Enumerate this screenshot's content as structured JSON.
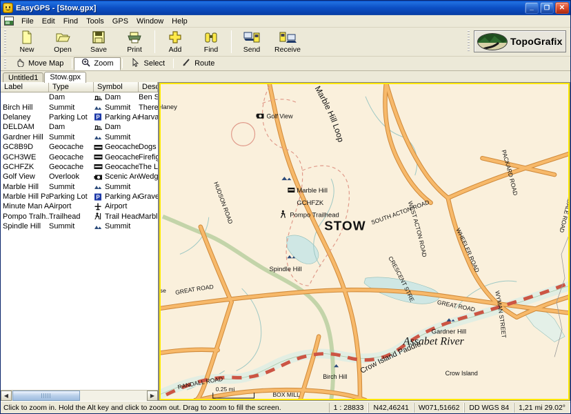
{
  "window": {
    "title": "EasyGPS - [Stow.gpx]",
    "app_icon": "smiley-icon",
    "minimize": "_",
    "maximize": "❐",
    "close": "✕"
  },
  "menu": {
    "items": [
      "File",
      "Edit",
      "Find",
      "Tools",
      "GPS",
      "Window",
      "Help"
    ]
  },
  "toolbar": {
    "buttons": [
      {
        "label": "New",
        "icon": "new-document-icon"
      },
      {
        "label": "Open",
        "icon": "open-folder-icon"
      },
      {
        "label": "Save",
        "icon": "floppy-disk-icon"
      },
      {
        "label": "Print",
        "icon": "printer-icon"
      },
      {
        "label": "Add",
        "icon": "plus-cross-icon"
      },
      {
        "label": "Find",
        "icon": "binoculars-icon"
      },
      {
        "label": "Send",
        "icon": "send-to-gps-icon"
      },
      {
        "label": "Receive",
        "icon": "receive-from-gps-icon"
      }
    ],
    "logo": {
      "text": "TopoGrafix",
      "icon": "topografix-oval-logo"
    }
  },
  "modebar": {
    "modes": [
      {
        "label": "Move Map",
        "icon": "hand-icon",
        "active": false
      },
      {
        "label": "Zoom",
        "icon": "magnifier-plus-icon",
        "active": true
      },
      {
        "label": "Select",
        "icon": "arrow-cursor-icon",
        "active": false
      },
      {
        "label": "Route",
        "icon": "pencil-line-icon",
        "active": false
      }
    ]
  },
  "tabs": [
    {
      "label": "Untitled1",
      "active": false
    },
    {
      "label": "Stow.gpx",
      "active": true
    }
  ],
  "list": {
    "columns": [
      "Label",
      "Type",
      "Symbol",
      "Description"
    ],
    "rows": [
      {
        "label": "",
        "type": "Dam",
        "symbol": "Dam",
        "symbol_icon": "dam-icon",
        "description": "Ben Smit"
      },
      {
        "label": "Birch Hill",
        "type": "Summit",
        "symbol": "Summit",
        "symbol_icon": "summit-icon",
        "description": "There ar"
      },
      {
        "label": "Delaney",
        "type": "Parking Lot",
        "symbol": "Parking Area",
        "symbol_icon": "parking-icon",
        "description": "Harvard "
      },
      {
        "label": "DELDAM",
        "type": "Dam",
        "symbol": "Dam",
        "symbol_icon": "dam-icon",
        "description": ""
      },
      {
        "label": "Gardner Hill",
        "type": "Summit",
        "symbol": "Summit",
        "symbol_icon": "summit-icon",
        "description": ""
      },
      {
        "label": "GC8B9D",
        "type": "Geocache",
        "symbol": "Geocache",
        "symbol_icon": "geocache-icon",
        "description": "Dogs at "
      },
      {
        "label": "GCH3WE",
        "type": "Geocache",
        "symbol": "Geocache",
        "symbol_icon": "geocache-icon",
        "description": "Firefight"
      },
      {
        "label": "GCHFZK",
        "type": "Geocache",
        "symbol": "Geocache",
        "symbol_icon": "geocache-icon",
        "description": "The Losl"
      },
      {
        "label": "Golf View",
        "type": "Overlook",
        "symbol": "Scenic Area",
        "symbol_icon": "camera-icon",
        "description": "Wedgev"
      },
      {
        "label": "Marble Hill",
        "type": "Summit",
        "symbol": "Summit",
        "symbol_icon": "summit-icon",
        "description": ""
      },
      {
        "label": "Marble Hill Pa...",
        "type": "Parking Lot",
        "symbol": "Parking Area",
        "symbol_icon": "parking-icon",
        "description": "Gravel p"
      },
      {
        "label": "Minute Man A...",
        "type": "Airport",
        "symbol": "Airport",
        "symbol_icon": "airport-icon",
        "description": ""
      },
      {
        "label": "Pompo Tralh...",
        "type": "Trailhead",
        "symbol": "Trail Head",
        "symbol_icon": "hiker-icon",
        "description": "Marble H"
      },
      {
        "label": "Spindle Hill",
        "type": "Summit",
        "symbol": "Summit",
        "symbol_icon": "summit-icon",
        "description": ""
      }
    ]
  },
  "map": {
    "waypoints": [
      {
        "name": "Golf View",
        "icon": "camera-icon"
      },
      {
        "name": "Marble Hill",
        "icon": "geocache-icon"
      },
      {
        "name": "GCHFZK",
        "icon": ""
      },
      {
        "name": "Pompo Trailhead",
        "icon": "hiker-icon"
      },
      {
        "name": "Delaney",
        "icon": ""
      },
      {
        "name": "Spindle Hill",
        "icon": "summit-icon"
      },
      {
        "name": "Birch Hill",
        "icon": "summit-icon"
      },
      {
        "name": "Gardner Hill",
        "icon": "summit-icon"
      },
      {
        "name": "Crow Island",
        "icon": ""
      }
    ],
    "place_labels": [
      "STOW",
      "Assabet River",
      "Crow Island Paddle"
    ],
    "road_labels": [
      "GREAT ROAD",
      "PACKARD ROAD",
      "SOUTH ACTON ROAD",
      "WEST ACTON ROAD",
      "CRESCENT STRE",
      "GREAT ROAD",
      "HUDSON ROAD",
      "RANDALL ROAD",
      "WYMAN STREET",
      "WHEELER ROAD",
      "SUNDALE ROAD",
      "BOX MILL",
      "Marble Hill Loop"
    ],
    "scale_label": "0.25 mi"
  },
  "status": {
    "hint": "Click to zoom in.  Hold the Alt key and click to zoom out.  Drag to zoom to fill the screen.",
    "scale": "1 : 28833",
    "latitude": "N42,46241",
    "longitude": "W071,51662",
    "datum": "DD WGS 84",
    "distance": "1,21 mi 29.02°"
  },
  "colors": {
    "title_blue": "#0a50c8",
    "chrome": "#ece9d8",
    "map_bg": "#faf0dc",
    "road": "#f2a85c",
    "frame_yellow": "#ffe800",
    "route_red": "#cc5544",
    "water": "#cfe7e4"
  }
}
